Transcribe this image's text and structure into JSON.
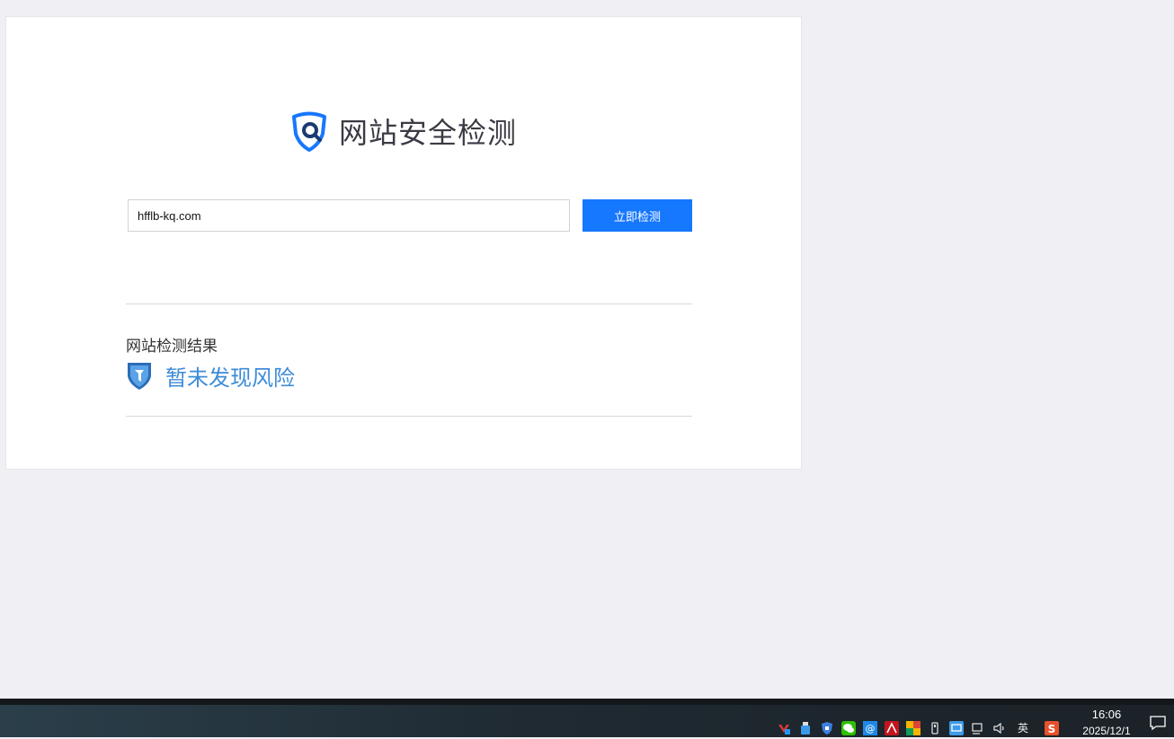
{
  "header": {
    "logo_icon": "shield-search-icon",
    "title": "网站安全检测"
  },
  "search": {
    "value": "hfflb-kq.com",
    "button_label": "立即检测"
  },
  "result": {
    "section_title": "网站检测结果",
    "status_icon": "shield-check-icon",
    "status_text": "暂未发现风险",
    "status_color": "#3d8bd9"
  },
  "colors": {
    "accent": "#1677ff",
    "background": "#f0eff4"
  },
  "taskbar": {
    "tray_icons": [
      "app-red-icon",
      "usb-drive-icon",
      "security-shield-icon",
      "wechat-icon",
      "mail-icon",
      "acrobat-icon",
      "color-app-icon",
      "usb-eject-icon",
      "network-app-icon",
      "network-icon",
      "volume-icon"
    ],
    "ime": "英",
    "ime_app_icon": "sogou-icon",
    "time": "16:06",
    "date": "2025/12/1"
  }
}
